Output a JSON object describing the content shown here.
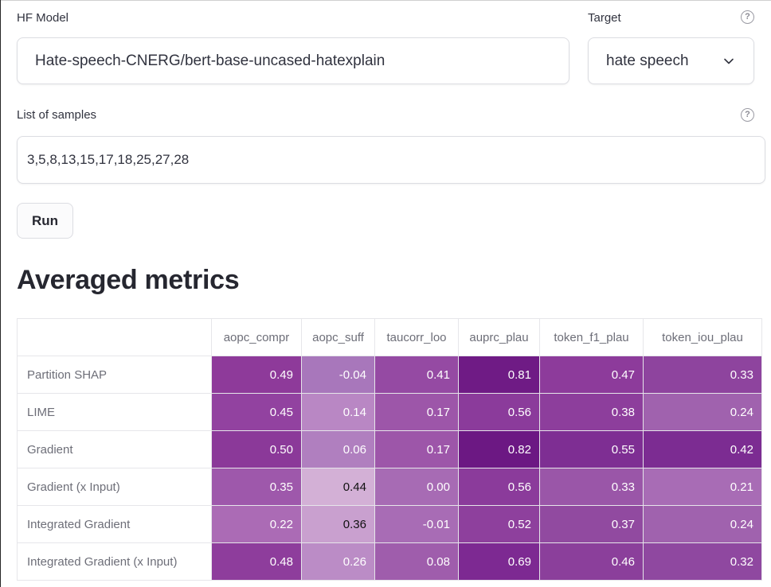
{
  "form": {
    "model_label": "HF Model",
    "model_value": "Hate-speech-CNERG/bert-base-uncased-hatexplain",
    "target_label": "Target",
    "target_value": "hate speech",
    "samples_label": "List of samples",
    "samples_value": "3,5,8,13,15,17,18,25,27,28",
    "help_glyph": "?",
    "run_label": "Run"
  },
  "results": {
    "heading": "Averaged metrics",
    "columns": [
      "aopc_compr",
      "aopc_suff",
      "taucorr_loo",
      "auprc_plau",
      "token_f1_plau",
      "token_iou_plau"
    ],
    "rows": [
      {
        "label": "Partition SHAP",
        "values": [
          "0.49",
          "-0.04",
          "0.41",
          "0.81",
          "0.47",
          "0.33"
        ]
      },
      {
        "label": "LIME",
        "values": [
          "0.45",
          "0.14",
          "0.17",
          "0.56",
          "0.38",
          "0.24"
        ]
      },
      {
        "label": "Gradient",
        "values": [
          "0.50",
          "0.06",
          "0.17",
          "0.82",
          "0.55",
          "0.42"
        ]
      },
      {
        "label": "Gradient (x Input)",
        "values": [
          "0.35",
          "0.44",
          "0.00",
          "0.56",
          "0.33",
          "0.21"
        ]
      },
      {
        "label": "Integrated Gradient",
        "values": [
          "0.22",
          "0.36",
          "-0.01",
          "0.52",
          "0.37",
          "0.24"
        ]
      },
      {
        "label": "Integrated Gradient (x Input)",
        "values": [
          "0.48",
          "0.26",
          "0.08",
          "0.69",
          "0.46",
          "0.32"
        ]
      }
    ],
    "cell_colors": [
      [
        "#8e3a9a",
        "#a877bb",
        "#954aa3",
        "#6f1b85",
        "#8d3b9b",
        "#8e449e"
      ],
      [
        "#9242a0",
        "#b987c4",
        "#9d56a9",
        "#8b3b9b",
        "#8d3e9c",
        "#a062ae"
      ],
      [
        "#8b3999",
        "#b07fbf",
        "#9d56a9",
        "#6c1883",
        "#7e2e93",
        "#7c2c92"
      ],
      [
        "#9e58ab",
        "#d3b0d6",
        "#a76bb4",
        "#8b3b9b",
        "#9a56a8",
        "#a86cb5"
      ],
      [
        "#ab6bb5",
        "#c9a0cf",
        "#a86cb5",
        "#8e409d",
        "#914aa0",
        "#a062ae"
      ],
      [
        "#8e3d9c",
        "#bb8cc6",
        "#9f5dac",
        "#7d2992",
        "#8b3f9b",
        "#8f48a0"
      ]
    ],
    "text_colors": [
      [
        "#ffffff",
        "#ffffff",
        "#ffffff",
        "#ffffff",
        "#ffffff",
        "#ffffff"
      ],
      [
        "#ffffff",
        "#ffffff",
        "#ffffff",
        "#ffffff",
        "#ffffff",
        "#ffffff"
      ],
      [
        "#ffffff",
        "#ffffff",
        "#ffffff",
        "#ffffff",
        "#ffffff",
        "#ffffff"
      ],
      [
        "#ffffff",
        "#111111",
        "#ffffff",
        "#ffffff",
        "#ffffff",
        "#ffffff"
      ],
      [
        "#ffffff",
        "#111111",
        "#ffffff",
        "#ffffff",
        "#ffffff",
        "#ffffff"
      ],
      [
        "#ffffff",
        "#ffffff",
        "#ffffff",
        "#ffffff",
        "#ffffff",
        "#ffffff"
      ]
    ]
  }
}
